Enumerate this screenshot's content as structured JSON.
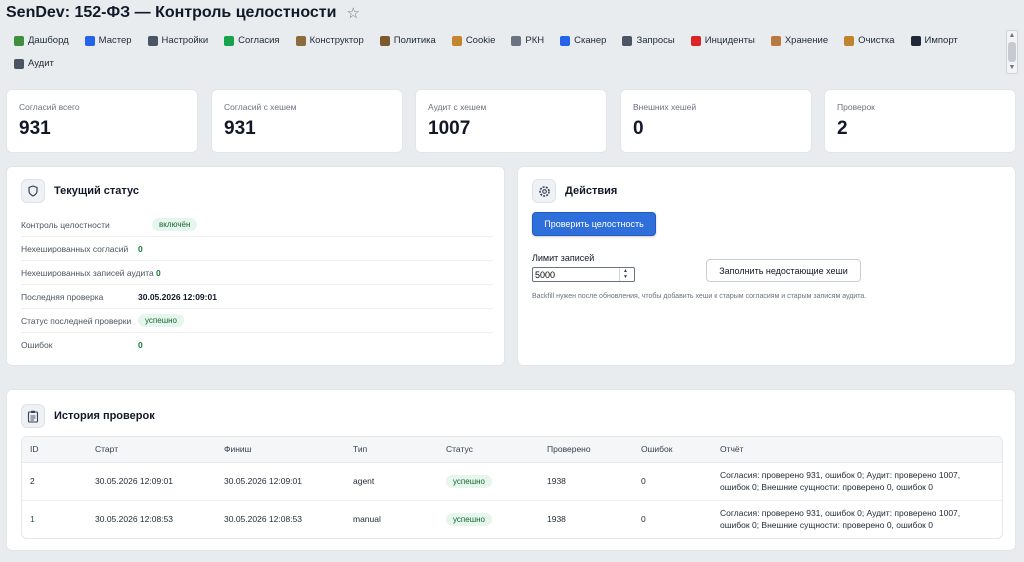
{
  "header": {
    "title": "SenDev: 152-ФЗ — Контроль целостности"
  },
  "nav": {
    "items": [
      {
        "label": "Дашборд",
        "icon": "dashboard-icon",
        "color": "#3f8f3f"
      },
      {
        "label": "Мастер",
        "icon": "wizard-icon",
        "color": "#2563eb"
      },
      {
        "label": "Настройки",
        "icon": "gear-icon",
        "color": "#4b5563"
      },
      {
        "label": "Согласия",
        "icon": "check-box-icon",
        "color": "#16a34a"
      },
      {
        "label": "Конструктор",
        "icon": "builder-icon",
        "color": "#8b6b3d"
      },
      {
        "label": "Политика",
        "icon": "policy-icon",
        "color": "#7c5a2e"
      },
      {
        "label": "Cookie",
        "icon": "cookie-icon",
        "color": "#c2862f"
      },
      {
        "label": "РКН",
        "icon": "document-icon",
        "color": "#6b7280"
      },
      {
        "label": "Сканер",
        "icon": "magnifier-icon",
        "color": "#2563eb"
      },
      {
        "label": "Запросы",
        "icon": "trash-icon",
        "color": "#4b5563"
      },
      {
        "label": "Инциденты",
        "icon": "siren-icon",
        "color": "#dc2626"
      },
      {
        "label": "Хранение",
        "icon": "archive-icon",
        "color": "#b7793d"
      },
      {
        "label": "Очистка",
        "icon": "broom-icon",
        "color": "#c0842f"
      },
      {
        "label": "Импорт",
        "icon": "import-icon",
        "color": "#1f2937"
      },
      {
        "label": "Аудит",
        "icon": "audit-icon",
        "color": "#4b5563"
      }
    ]
  },
  "stats": [
    {
      "label": "Согласий всего",
      "value": "931"
    },
    {
      "label": "Согласий с хешем",
      "value": "931"
    },
    {
      "label": "Аудит с хешем",
      "value": "1007"
    },
    {
      "label": "Внешних хешей",
      "value": "0"
    },
    {
      "label": "Проверок",
      "value": "2"
    }
  ],
  "status": {
    "title": "Текущий статус",
    "rows": [
      {
        "label": "Контроль целостности",
        "value": "включён"
      },
      {
        "label": "Нехешированных согласий",
        "value": "0"
      },
      {
        "label": "Нехешированных записей аудита",
        "value": "0"
      },
      {
        "label": "Последняя проверка",
        "value": "30.05.2026 12:09:01"
      },
      {
        "label": "Статус последней проверки",
        "value": "успешно"
      },
      {
        "label": "Ошибок",
        "value": "0"
      }
    ]
  },
  "actions": {
    "title": "Действия",
    "verify_button": "Проверить целостность",
    "limit_label": "Лимит записей",
    "limit_value": "5000",
    "backfill_button": "Заполнить недостающие хеши",
    "hint": "Backfill нужен после обновления, чтобы добавить хеши к старым согласиям и старым записям аудита."
  },
  "history": {
    "title": "История проверок",
    "columns": [
      "ID",
      "Старт",
      "Финиш",
      "Тип",
      "Статус",
      "Проверено",
      "Ошибок",
      "Отчёт"
    ],
    "rows": [
      {
        "id": "2",
        "start": "30.05.2026 12:09:01",
        "finish": "30.05.2026 12:09:01",
        "type": "agent",
        "status": "успешно",
        "checked": "1938",
        "errors": "0",
        "report_line1": "Согласия: проверено 931, ошибок 0; Аудит: проверено 1007,",
        "report_line2": "ошибок 0; Внешние сущности: проверено 0, ошибок 0"
      },
      {
        "id": "1",
        "start": "30.05.2026 12:08:53",
        "finish": "30.05.2026 12:08:53",
        "type": "manual",
        "status": "успешно",
        "checked": "1938",
        "errors": "0",
        "report_line1": "Согласия: проверено 931, ошибок 0; Аудит: проверено 1007,",
        "report_line2": "ошибок 0; Внешние сущности: проверено 0, ошибок 0"
      }
    ]
  }
}
